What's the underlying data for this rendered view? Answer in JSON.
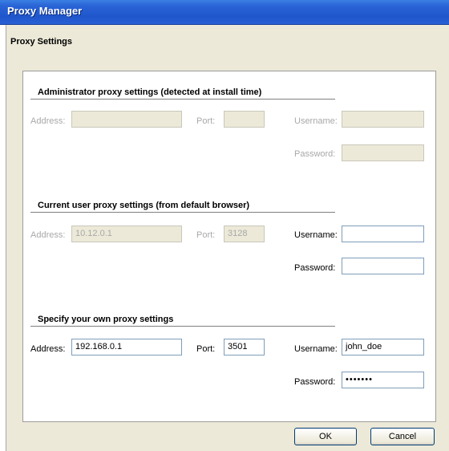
{
  "window": {
    "title": "Proxy Manager"
  },
  "page": {
    "heading": "Proxy Settings"
  },
  "labels": {
    "address": "Address:",
    "port": "Port:",
    "username": "Username:",
    "password": "Password:"
  },
  "admin": {
    "title": "Administrator proxy settings (detected at install time)",
    "enabled": false,
    "address": "",
    "port": "",
    "username": "",
    "password": ""
  },
  "current": {
    "title": "Current user proxy settings (from default browser)",
    "enabled_address_port": false,
    "address": "10.12.0.1",
    "port": "3128",
    "username": "",
    "password": ""
  },
  "own": {
    "title": "Specify your own proxy settings",
    "enabled": true,
    "address": "192.168.0.1",
    "port": "3501",
    "username": "john_doe",
    "password": "•••••••"
  },
  "buttons": {
    "ok": "OK",
    "cancel": "Cancel"
  }
}
